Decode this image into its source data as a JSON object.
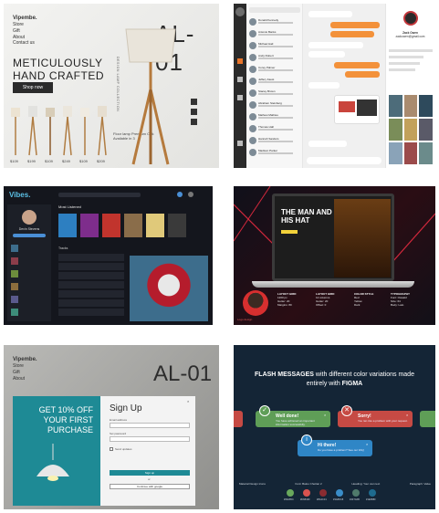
{
  "tiles": {
    "lamp": {
      "brand": "Vipembe.",
      "nav": [
        "Store",
        "Gift",
        "About",
        "Contact us"
      ],
      "headline": "METICULOUSLY HAND CRAFTED",
      "cta": "Shop now",
      "model": "AL-01",
      "side_text": "DESIGN LAMP COLLECTION",
      "description": "Floor lamp Premium Oak Available in 3",
      "prices": [
        "$109",
        "$199",
        "$109",
        "$249",
        "$109",
        "$209"
      ]
    },
    "chat": {
      "contacts": [
        "Donald Kennedy",
        "Antonio Banks",
        "Michael Hail",
        "Andy Robert",
        "Corey Palmer",
        "Jeffery Faust",
        "Stacey Brown",
        "Abraham Steinberg",
        "Mathew Mathieu",
        "Thomas Hall",
        "Hannah Sanders",
        "Madison Parker"
      ],
      "profile_name": "Zack Owen",
      "profile_handle": "zackowen@gmail.com"
    },
    "music": {
      "brand": "Vibes.",
      "user": "Devin Stevens",
      "section_title": "Most Listened",
      "list_title": "Tracks"
    },
    "movie": {
      "headline": "THE MAN AND HIS HAT",
      "avatar_caption": "Logo design",
      "columns": [
        {
          "title": "LAYOUT GRID",
          "lines": [
            "1200 px",
            "Gutter: 20",
            "Margins: 80"
          ]
        },
        {
          "title": "LAYOUT GRID",
          "lines": [
            "12 columns",
            "Gutter: 20",
            "Offset: 0"
          ]
        },
        {
          "title": "COLOR STYLE",
          "lines": [
            "Red",
            "Yellow",
            "Dark"
          ]
        },
        {
          "title": "TYPOGRAPHY",
          "lines": [
            "Font: Oswald",
            "Size: 64",
            "Body: Lato"
          ]
        }
      ]
    },
    "signup": {
      "brand": "Vipembe.",
      "model": "AL-01",
      "promo": "GET 10% OFF YOUR FIRST PURCHASE",
      "title": "Sign Up",
      "label_email": "Email address",
      "label_password": "Set password",
      "checkbox": "Send updates",
      "submit": "Sign up",
      "or": "or",
      "google": "Continue with google",
      "close": "×"
    },
    "flash": {
      "title_bold": "FLASH MESSAGES",
      "title_rest": "with different color variations made entirely with",
      "title_brand": "FIGMA",
      "success_title": "Well done!",
      "success_body": "You have achieved an important information successfully.",
      "error_title": "Sorry!",
      "error_body": "You ran into a problem with your request.",
      "info_title": "Hi there!",
      "info_body": "Do you have a problem? See our FAQ",
      "footer_items": [
        "Material Design Icons",
        "Font: Baloo Chettan 2",
        "Heading: Your own text",
        "Paragraph: Value"
      ],
      "swatch_labels": [
        "#69A85C",
        "#D9534F",
        "#8A2C31",
        "#3A8DC8",
        "#4F7A6B",
        "#1E6B8F"
      ],
      "colors": {
        "success": "#5f9e57",
        "error": "#c64a44",
        "info": "#2f86c6"
      }
    }
  }
}
